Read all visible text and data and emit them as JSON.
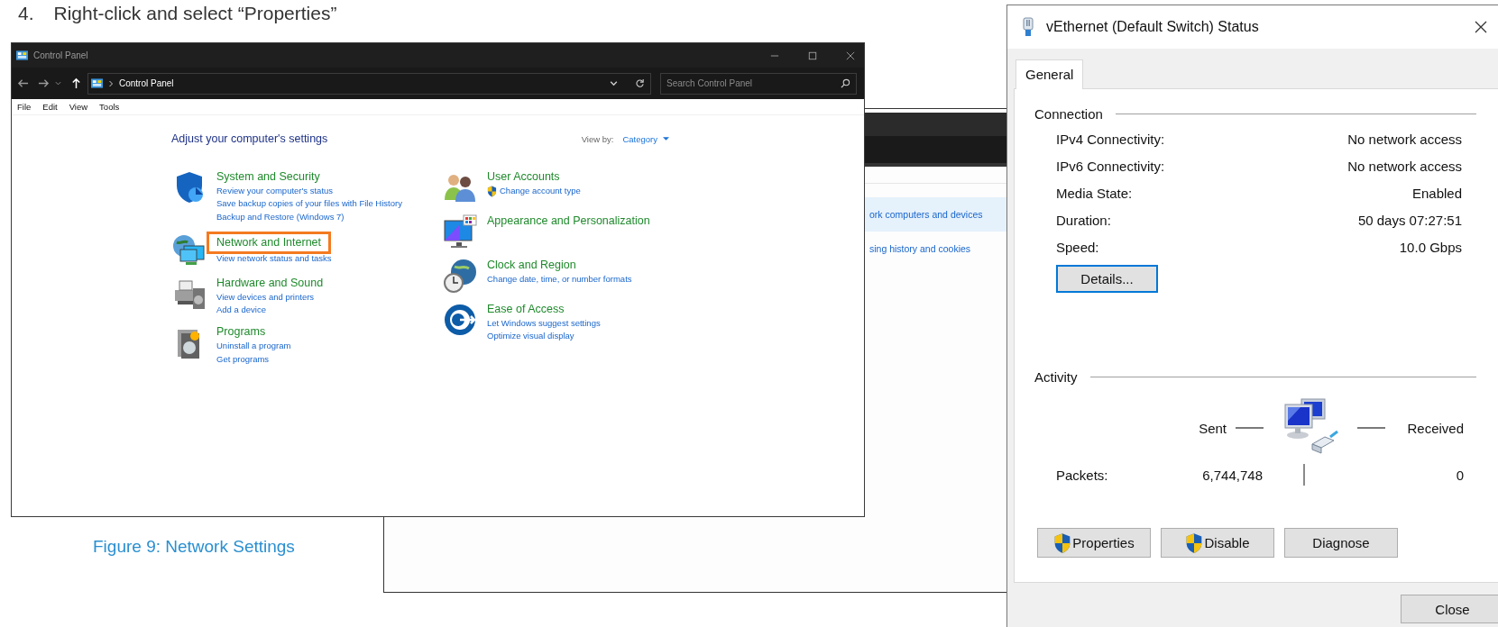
{
  "step": {
    "number": "4.",
    "text": "Right-click and select “Properties”"
  },
  "control_panel": {
    "title": "Control Panel",
    "address": "Control Panel",
    "search_placeholder": "Search Control Panel",
    "menu": [
      "File",
      "Edit",
      "View",
      "Tools"
    ],
    "heading": "Adjust your computer's settings",
    "view_by_label": "View by:",
    "view_by_value": "Category",
    "columns": [
      [
        {
          "title": "System and Security",
          "highlighted": false,
          "links": [
            {
              "text": "Review your computer's status",
              "shield": false
            },
            {
              "text": "Save backup copies of your files with File History",
              "shield": false
            },
            {
              "text": "Backup and Restore (Windows 7)",
              "shield": false
            }
          ]
        },
        {
          "title": "Network and Internet",
          "highlighted": true,
          "links": [
            {
              "text": "View network status and tasks",
              "shield": false
            }
          ]
        },
        {
          "title": "Hardware and Sound",
          "highlighted": false,
          "links": [
            {
              "text": "View devices and printers",
              "shield": false
            },
            {
              "text": "Add a device",
              "shield": false
            }
          ]
        },
        {
          "title": "Programs",
          "highlighted": false,
          "links": [
            {
              "text": "Uninstall a program",
              "shield": false
            },
            {
              "text": "Get programs",
              "shield": false
            }
          ]
        }
      ],
      [
        {
          "title": "User Accounts",
          "highlighted": false,
          "links": [
            {
              "text": "Change account type",
              "shield": true
            }
          ]
        },
        {
          "title": "Appearance and Personalization",
          "highlighted": false
        },
        {
          "title": "Clock and Region",
          "highlighted": false,
          "links": [
            {
              "text": "Change date, time, or number formats",
              "shield": false
            }
          ]
        },
        {
          "title": "Ease of Access",
          "highlighted": false,
          "links": [
            {
              "text": "Let Windows suggest settings",
              "shield": false
            },
            {
              "text": "Optimize visual display",
              "shield": false
            }
          ]
        }
      ]
    ]
  },
  "figure_caption": "Figure 9: Network Settings",
  "background_window": {
    "links": [
      {
        "text": "ork computers and devices",
        "selected": true
      },
      {
        "text": "sing history and cookies",
        "selected": false
      }
    ]
  },
  "status_dialog": {
    "title": "vEthernet (Default Switch) Status",
    "tabs": [
      {
        "label": "General",
        "selected": true
      }
    ],
    "connection_label": "Connection",
    "rows": [
      {
        "label": "IPv4 Connectivity:",
        "value": "No network access"
      },
      {
        "label": "IPv6 Connectivity:",
        "value": "No network access"
      },
      {
        "label": "Media State:",
        "value": "Enabled"
      },
      {
        "label": "Duration:",
        "value": "50 days 07:27:51"
      },
      {
        "label": "Speed:",
        "value": "10.0 Gbps"
      }
    ],
    "details_button": "Details...",
    "activity_label": "Activity",
    "sent_label": "Sent",
    "received_label": "Received",
    "packets_label": "Packets:",
    "packets_sent": "6,744,748",
    "packets_received": "0",
    "buttons": [
      {
        "label": "Properties",
        "shield": true
      },
      {
        "label": "Disable",
        "shield": true
      },
      {
        "label": "Diagnose",
        "shield": false
      }
    ],
    "close_button": "Close"
  }
}
